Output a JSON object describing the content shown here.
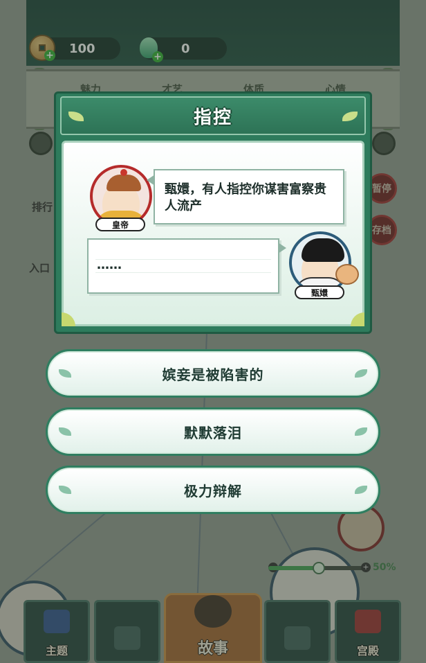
{
  "header": {
    "coins": "100",
    "jade": "0"
  },
  "background": {
    "stats": [
      "魅力",
      "才艺",
      "体质",
      "心情"
    ],
    "side_buttons": [
      "暂停",
      "存档"
    ],
    "left_labels": [
      "排行",
      "入口"
    ],
    "progress": {
      "percent_label": "50%",
      "value": 0.5
    }
  },
  "dialog": {
    "title": "指控",
    "speaker1": {
      "name": "皇帝",
      "line": "甄嬛，有人指控你谋害富察贵人流产"
    },
    "speaker2": {
      "name": "甄嬛",
      "line": "……"
    }
  },
  "choices": [
    {
      "label": "嫔妾是被陷害的"
    },
    {
      "label": "默默落泪"
    },
    {
      "label": "极力辩解"
    }
  ],
  "tabs": [
    {
      "label": "主题",
      "active": false
    },
    {
      "label": "",
      "active": false
    },
    {
      "label": "故事",
      "active": true
    },
    {
      "label": "",
      "active": false
    },
    {
      "label": "宫殿",
      "active": false
    }
  ],
  "colors": {
    "dialog_green": "#2e7b5c",
    "emperor_ring": "#b52b2b",
    "zhen_ring": "#2d5c7a",
    "active_tab": "#a0612d"
  }
}
